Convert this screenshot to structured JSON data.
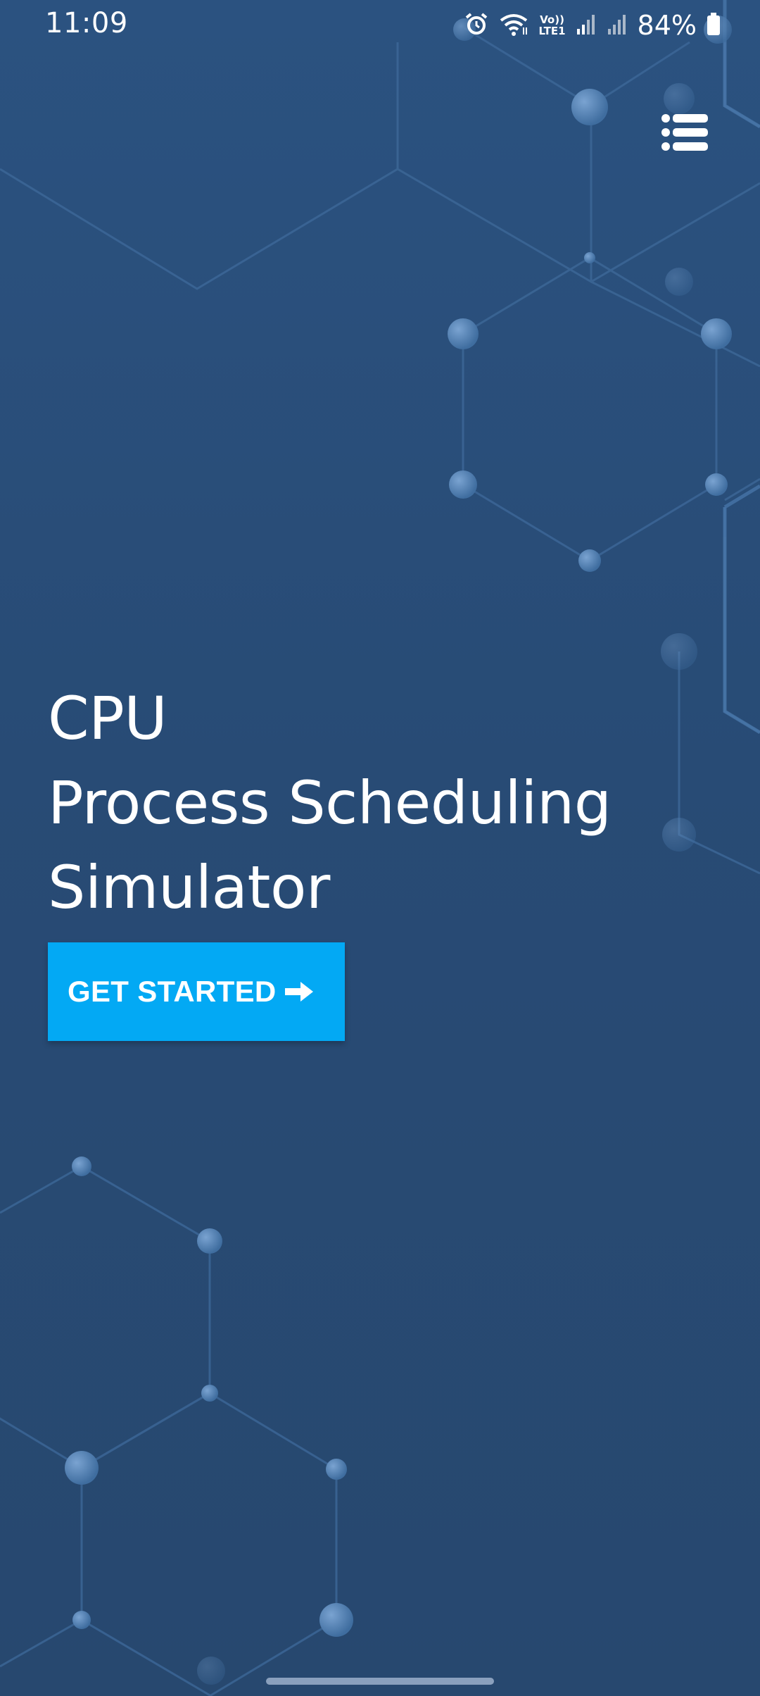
{
  "status_bar": {
    "time": "11:09",
    "network_label_top": "Vo))",
    "network_label_bottom": "LTE1",
    "battery_percent": "84%",
    "icons": [
      "alarm-icon",
      "wifi-icon",
      "signal-icon",
      "signal-icon",
      "battery-icon"
    ]
  },
  "header": {
    "menu_icon": "list-menu-icon"
  },
  "hero": {
    "title_line_1": "CPU",
    "title_line_2": "Process Scheduling",
    "title_line_3": "Simulator"
  },
  "cta": {
    "label": "GET STARTED",
    "icon": "arrow-right-icon",
    "background_color": "#03a9f4"
  },
  "colors": {
    "background": "#284b75",
    "network_lines": "#3e6a9b",
    "network_nodes": "#5d8bbf"
  }
}
